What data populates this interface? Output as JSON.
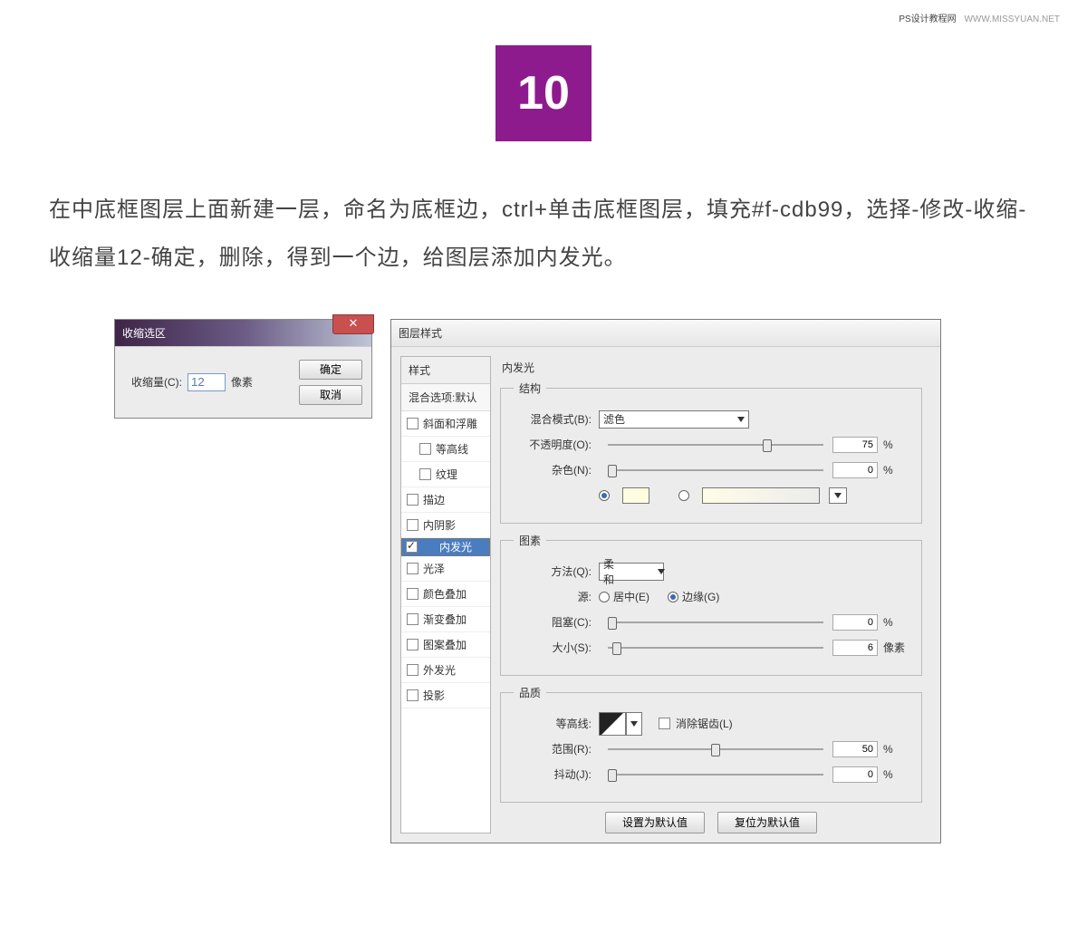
{
  "watermark": {
    "site": "PS设计教程网",
    "url": "WWW.MISSYUAN.NET"
  },
  "step": "10",
  "instruction": "在中底框图层上面新建一层，命名为底框边，ctrl+单击底框图层，填充#f-cdb99，选择-修改-收缩-收缩量12-确定，删除，得到一个边，给图层添加内发光。",
  "contract_dialog": {
    "title": "收缩选区",
    "label": "收缩量(C):",
    "value": "12",
    "unit": "像素",
    "ok": "确定",
    "cancel": "取消"
  },
  "layer_style": {
    "title": "图层样式",
    "left": {
      "header": "样式",
      "blend": "混合选项:默认",
      "items": [
        "斜面和浮雕",
        "等高线",
        "纹理",
        "描边",
        "内阴影",
        "内发光",
        "光泽",
        "颜色叠加",
        "渐变叠加",
        "图案叠加",
        "外发光",
        "投影"
      ],
      "sub_indices": [
        1,
        2
      ],
      "checked": [
        5
      ],
      "selected": 5
    },
    "section_title": "内发光",
    "structure": {
      "legend": "结构",
      "blend_mode_label": "混合模式(B):",
      "blend_mode_value": "滤色",
      "opacity_label": "不透明度(O):",
      "opacity_value": "75",
      "noise_label": "杂色(N):",
      "noise_value": "0",
      "percent": "%",
      "color_swatch": "#FFFDE0"
    },
    "elements": {
      "legend": "图素",
      "technique_label": "方法(Q):",
      "technique_value": "柔和",
      "source_label": "源:",
      "source_center": "居中(E)",
      "source_edge": "边缘(G)",
      "choke_label": "阻塞(C):",
      "choke_value": "0",
      "size_label": "大小(S):",
      "size_value": "6",
      "size_unit": "像素",
      "percent": "%"
    },
    "quality": {
      "legend": "品质",
      "contour_label": "等高线:",
      "antialias": "消除锯齿(L)",
      "range_label": "范围(R):",
      "range_value": "50",
      "jitter_label": "抖动(J):",
      "jitter_value": "0",
      "percent": "%"
    },
    "buttons": {
      "default": "设置为默认值",
      "reset": "复位为默认值"
    }
  }
}
